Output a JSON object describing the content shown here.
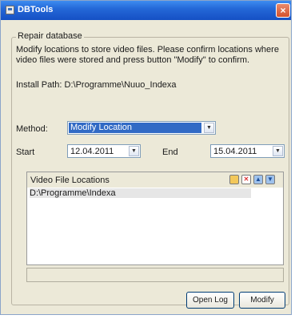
{
  "window": {
    "title": "DBTools",
    "close_glyph": "×"
  },
  "group": {
    "legend": "Repair database"
  },
  "description": "Modify locations to store video files. Please confirm locations where video files were stored and press button \"Modify\" to confirm.",
  "install_path": "Install Path: D:\\Programme\\Nuuo_Indexa",
  "method": {
    "label": "Method:",
    "value": "Modify Location"
  },
  "start": {
    "label": "Start",
    "value": "12.04.2011"
  },
  "end": {
    "label": "End",
    "value": "15.04.2011"
  },
  "dropdown_glyph": "▼",
  "video_locations": {
    "title": "Video File Locations",
    "items": [
      "D:\\Programme\\Indexa"
    ],
    "toolbar_icons": [
      "folder-icon",
      "delete-icon",
      "move-up-icon",
      "move-down-icon"
    ]
  },
  "progress": {
    "value_percent": 0
  },
  "buttons": {
    "open_log": "Open Log",
    "modify": "Modify"
  },
  "colors": {
    "accent": "#316ac5",
    "titlebar": "#2468d8",
    "window_bg": "#ece9d8"
  }
}
